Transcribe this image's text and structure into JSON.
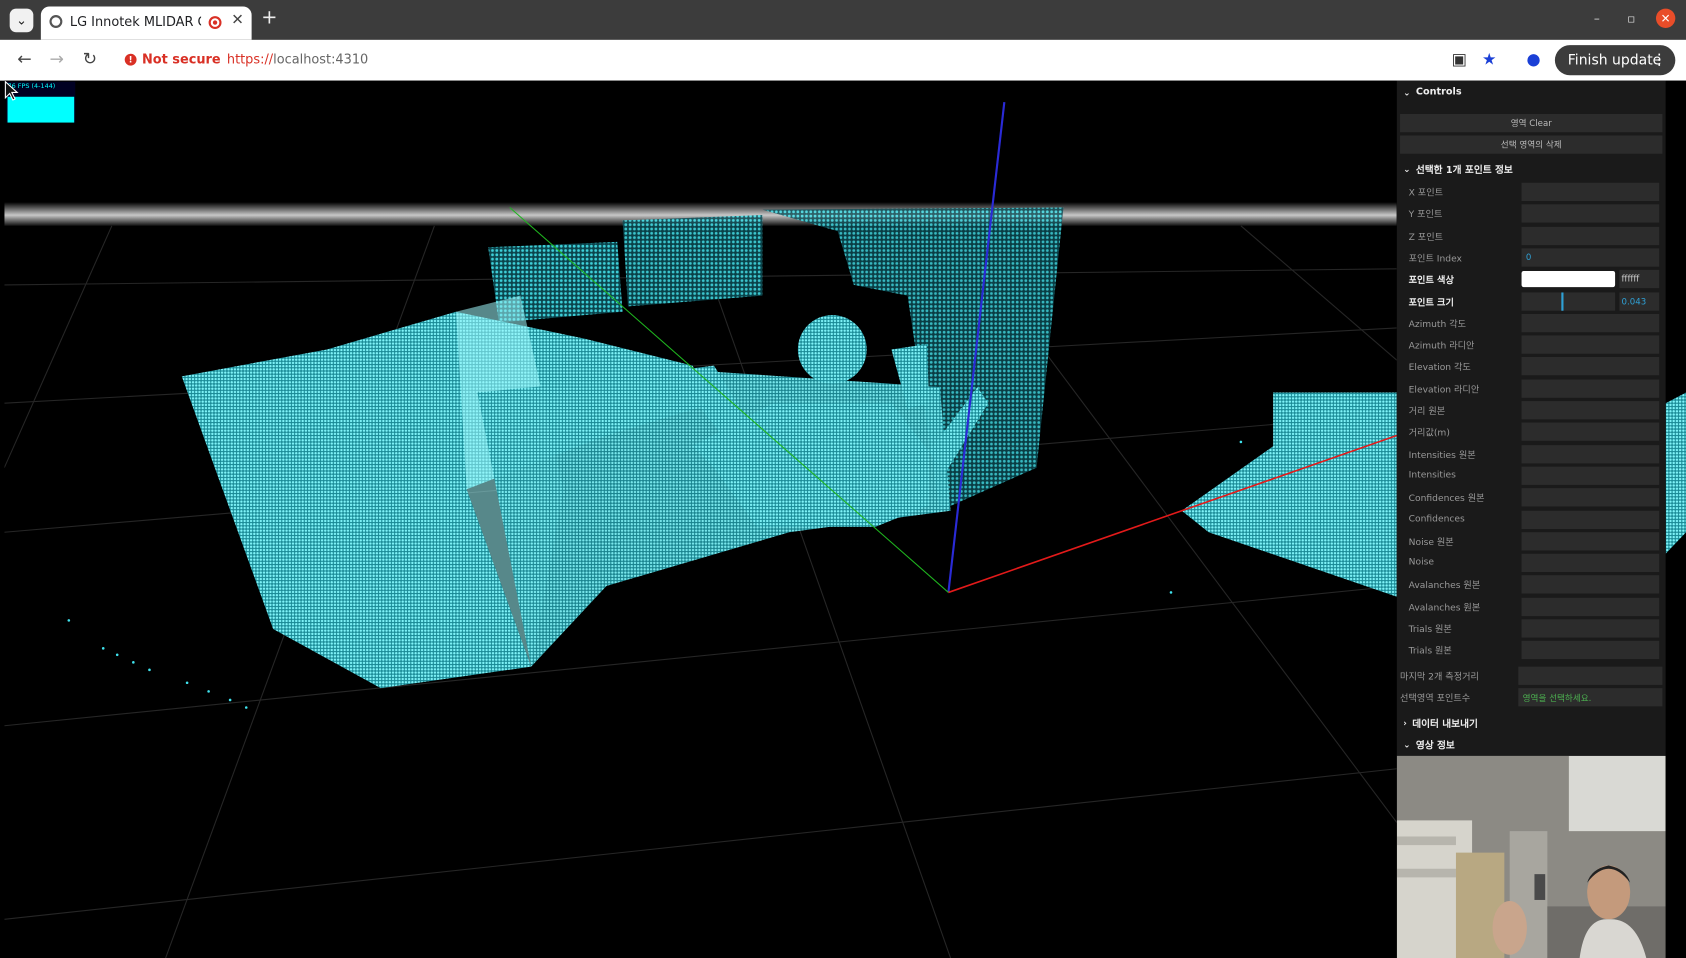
{
  "browser": {
    "tab_title": "LG Innotek MLIDAR C",
    "security_label": "Not secure",
    "url_scheme": "https://",
    "url_host": "localhost:4310",
    "finish_update_label": "Finish update",
    "icons": [
      "tab-list-icon",
      "globe-icon",
      "recording-icon",
      "close-icon",
      "plus-icon",
      "back-icon",
      "forward-icon",
      "reload-icon",
      "camera-icon",
      "star-icon",
      "profile-icon",
      "more-icon",
      "minimize-icon",
      "restore-icon"
    ]
  },
  "viewport": {
    "fps_label": "76 FPS (4-144)",
    "colors": {
      "points": "#3fe3ee",
      "axis_x": "#e31a1a",
      "axis_y": "#1fb51f",
      "axis_z": "#2a2ad6",
      "grid": "#2a2a2a"
    }
  },
  "panel": {
    "controls_title": "Controls",
    "buttons": [
      "영역 Clear",
      "선택 영역의 삭제"
    ],
    "point_info_title": "선택한 1개 포인트 정보",
    "rows": [
      {
        "label": "X 포인트",
        "value": ""
      },
      {
        "label": "Y 포인트",
        "value": ""
      },
      {
        "label": "Z 포인트",
        "value": ""
      },
      {
        "label": "포인트 Index",
        "value": "0"
      },
      {
        "label": "포인트 색상",
        "value": "ffffff"
      },
      {
        "label": "포인트 크기",
        "value": "0.043"
      },
      {
        "label": "Azimuth 각도",
        "value": ""
      },
      {
        "label": "Azimuth 라디안",
        "value": ""
      },
      {
        "label": "Elevation 각도",
        "value": ""
      },
      {
        "label": "Elevation 라디안",
        "value": ""
      },
      {
        "label": "거리 원본",
        "value": ""
      },
      {
        "label": "거리값(m)",
        "value": ""
      },
      {
        "label": "Intensities 원본",
        "value": ""
      },
      {
        "label": "Intensities",
        "value": ""
      },
      {
        "label": "Confidences 원본",
        "value": ""
      },
      {
        "label": "Confidences",
        "value": ""
      },
      {
        "label": "Noise 원본",
        "value": ""
      },
      {
        "label": "Noise",
        "value": ""
      },
      {
        "label": "Avalanches 원본",
        "value": ""
      },
      {
        "label": "Avalanches 원본",
        "value": ""
      },
      {
        "label": "Trials 원본",
        "value": ""
      },
      {
        "label": "Trials 원본",
        "value": ""
      }
    ],
    "last_distance_label": "마지막 2개 측정거리",
    "last_distance_value": "",
    "selected_count_label": "선택영역 포인트수",
    "selected_count_value": "영역을 선택하세요.",
    "export_title": "데이터 내보내기",
    "video_title": "영상 정보",
    "point_size_level": 0.42
  }
}
